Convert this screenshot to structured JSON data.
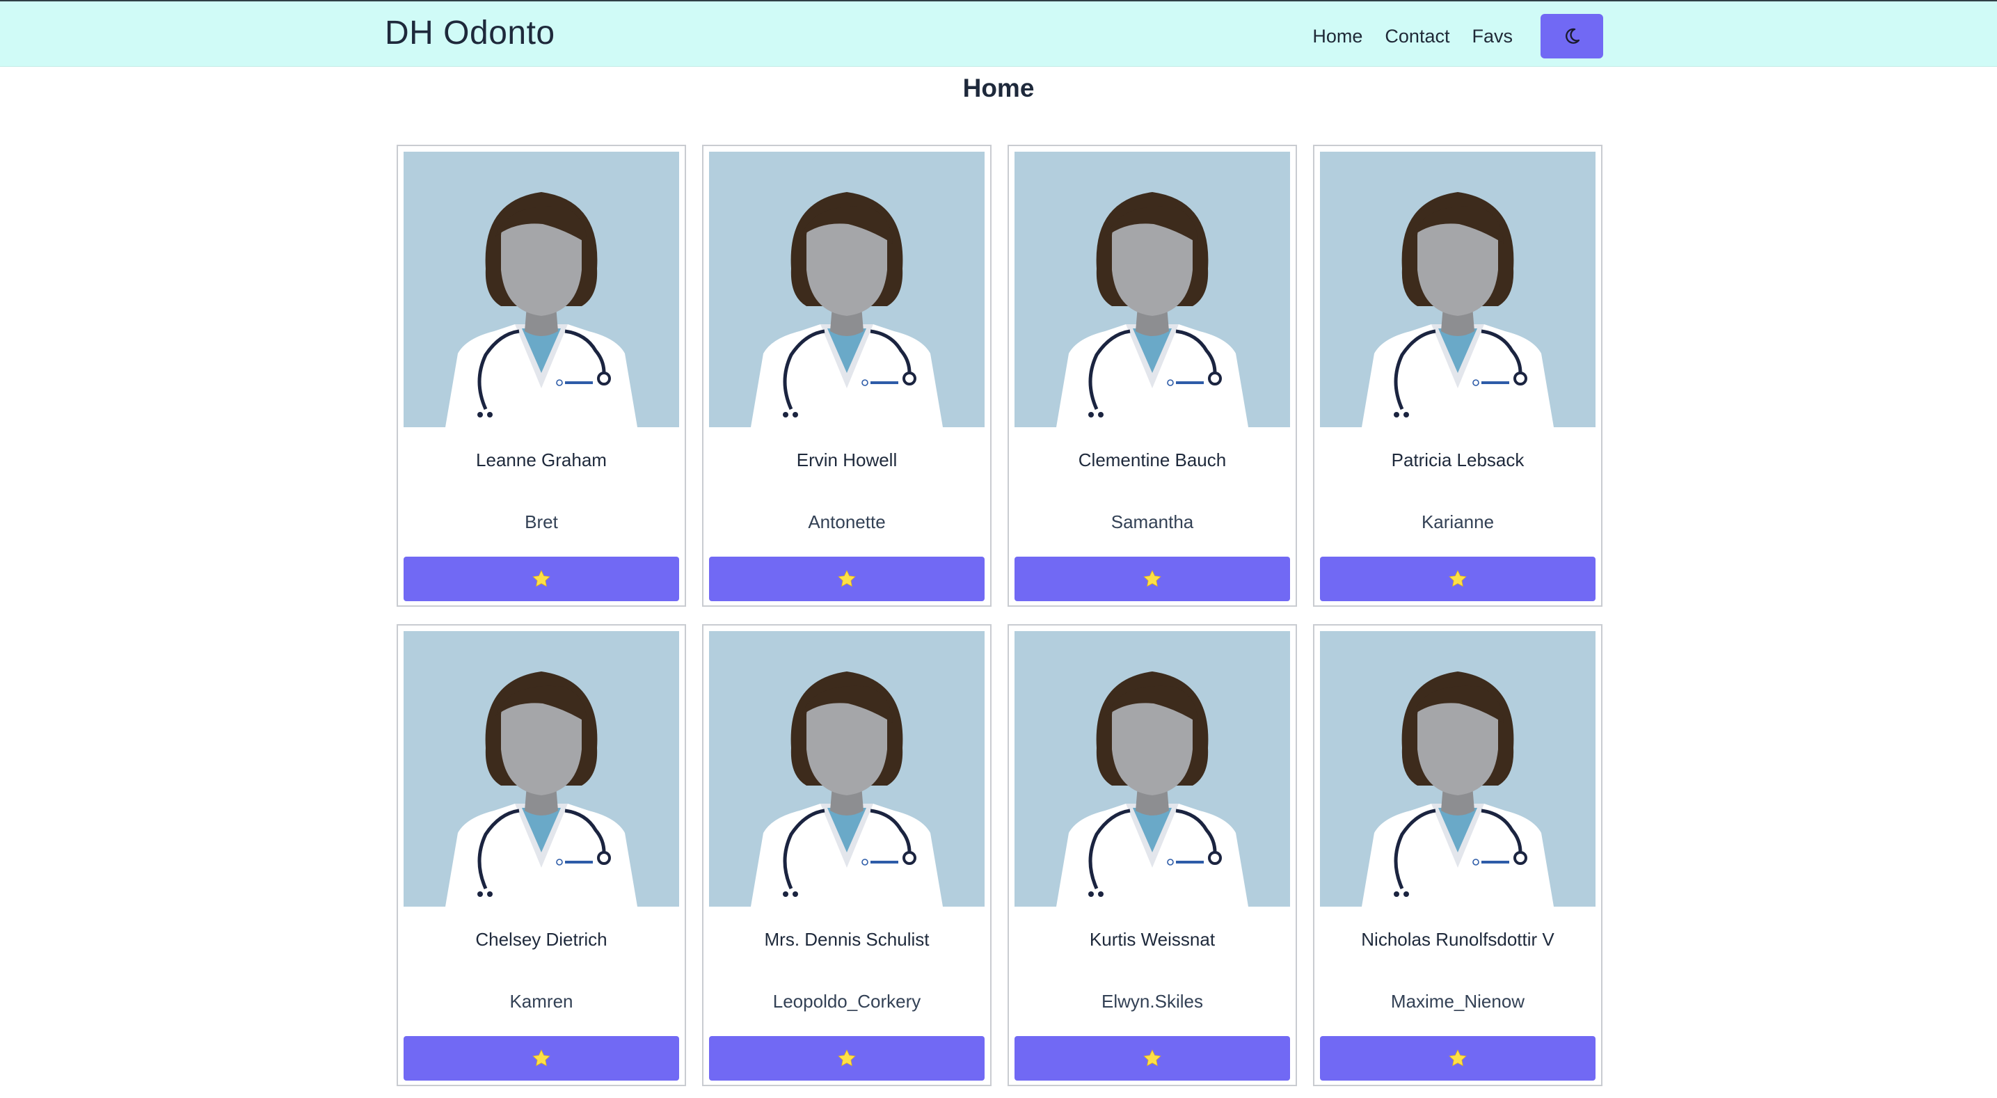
{
  "nav": {
    "brand": "DH Odonto",
    "links": [
      "Home",
      "Contact",
      "Favs"
    ],
    "theme_icon": "moon-icon"
  },
  "page": {
    "title": "Home"
  },
  "colors": {
    "navbar_bg": "#d0fbf7",
    "accent": "#7169f4",
    "star": "#fde047",
    "avatar_bg": "#b3cedd"
  },
  "cards": [
    {
      "name": "Leanne Graham",
      "username": "Bret"
    },
    {
      "name": "Ervin Howell",
      "username": "Antonette"
    },
    {
      "name": "Clementine Bauch",
      "username": "Samantha"
    },
    {
      "name": "Patricia Lebsack",
      "username": "Karianne"
    },
    {
      "name": "Chelsey Dietrich",
      "username": "Kamren"
    },
    {
      "name": "Mrs. Dennis Schulist",
      "username": "Leopoldo_Corkery"
    },
    {
      "name": "Kurtis Weissnat",
      "username": "Elwyn.Skiles"
    },
    {
      "name": "Nicholas Runolfsdottir V",
      "username": "Maxime_Nienow"
    }
  ],
  "card_icons": {
    "avatar": "doctor-avatar",
    "favorite": "star-icon"
  }
}
